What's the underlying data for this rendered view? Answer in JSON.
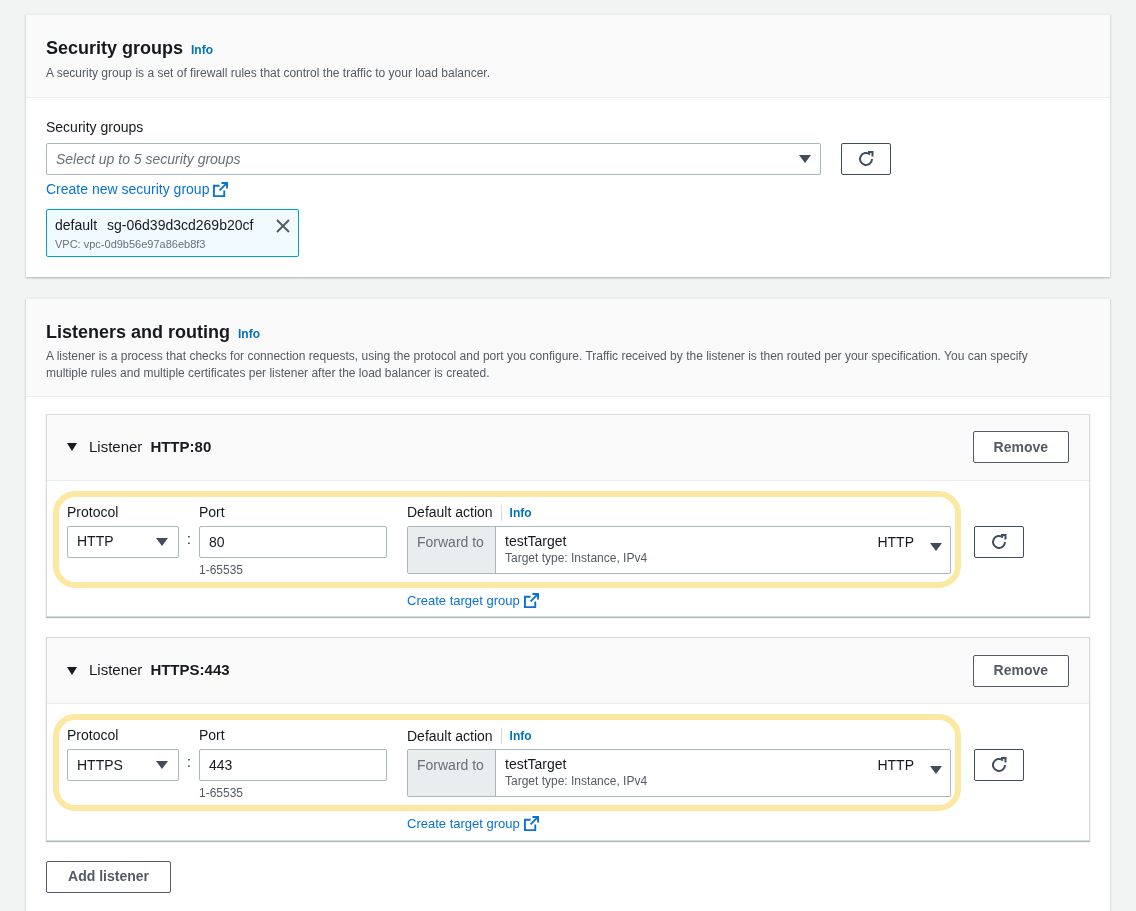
{
  "security_groups": {
    "title": "Security groups",
    "info": "Info",
    "description": "A security group is a set of firewall rules that control the traffic to your load balancer.",
    "field_label": "Security groups",
    "placeholder": "Select up to 5 security groups",
    "create_link": "Create new security group",
    "selected_groups": [
      {
        "name": "default",
        "id": "sg-06d39d3cd269b20cf",
        "vpc": "VPC: vpc-0d9b56e97a86eb8f3"
      }
    ]
  },
  "listeners_section": {
    "title": "Listeners and routing",
    "info": "Info",
    "description": "A listener is a process that checks for connection requests, using the protocol and port you configure. Traffic received by the listener is then routed per your specification. You can specify multiple rules and multiple certificates per listener after the load balancer is created.",
    "listeners": [
      {
        "expanded": true,
        "highlighted": true,
        "label": "Listener",
        "name": "HTTP:80",
        "remove": "Remove",
        "protocol_label": "Protocol",
        "protocol": "HTTP",
        "separator": ":",
        "port_label": "Port",
        "port": "80",
        "port_hint": "1-65535",
        "default_action_label": "Default action",
        "info": "Info",
        "forward_label": "Forward to",
        "target": "testTarget",
        "target_type": "Target type: Instance, IPv4",
        "target_protocol": "HTTP",
        "link": "Create target group"
      },
      {
        "expanded": true,
        "highlighted": true,
        "label": "Listener",
        "name": "HTTPS:443",
        "remove": "Remove",
        "protocol_label": "Protocol",
        "protocol": "HTTPS",
        "separator": ":",
        "port_label": "Port",
        "port": "443",
        "port_hint": "1-65535",
        "default_action_label": "Default action",
        "info": "Info",
        "forward_label": "Forward to",
        "target": "testTarget",
        "target_type": "Target type: Instance, IPv4",
        "target_protocol": "HTTP",
        "link": "Create target group"
      }
    ],
    "add_button": "Add listener"
  }
}
